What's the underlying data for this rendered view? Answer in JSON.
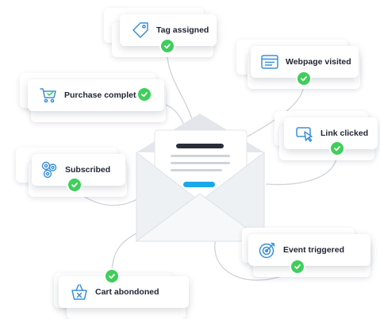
{
  "nodes": [
    {
      "id": "tag",
      "label": "Tag assigned",
      "icon": "tag-icon"
    },
    {
      "id": "webpage",
      "label": "Webpage visited",
      "icon": "webpage-icon"
    },
    {
      "id": "purchase",
      "label": "Purchase completed",
      "icon": "shopping-cart-icon"
    },
    {
      "id": "link",
      "label": "Link clicked",
      "icon": "cursor-click-icon"
    },
    {
      "id": "subscribed",
      "label": "Subscribed",
      "icon": "subscribers-icon"
    },
    {
      "id": "event",
      "label": "Event triggered",
      "icon": "target-icon"
    },
    {
      "id": "cart",
      "label": "Cart abondoned",
      "icon": "abandoned-basket-icon"
    }
  ],
  "center": {
    "icon": "email-envelope-icon"
  },
  "colors": {
    "check": "#3fce5b",
    "accent": "#1aa8e8",
    "icon_stroke": "#3a8fd6",
    "connector": "#cfd3d8",
    "envelope": "#eef1f4"
  }
}
